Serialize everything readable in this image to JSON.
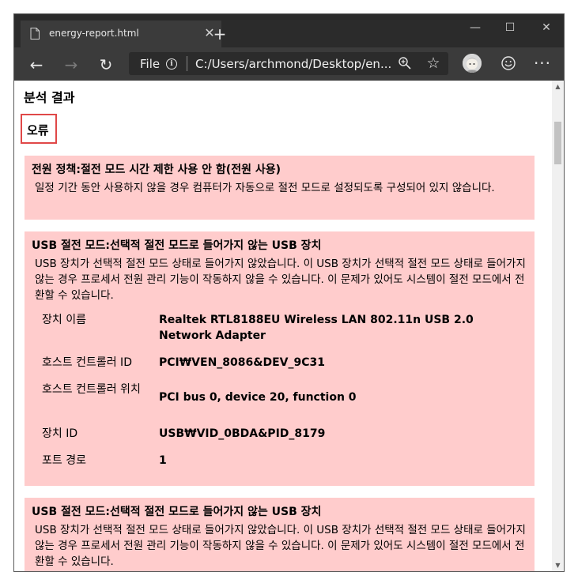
{
  "browser": {
    "tab_title": "energy-report.html",
    "new_tab_symbol": "+",
    "tab_close_symbol": "✕",
    "minimize_symbol": "—",
    "maximize_symbol": "☐",
    "close_symbol": "✕",
    "back_symbol": "←",
    "forward_symbol": "→",
    "refresh_symbol": "↻",
    "address_scheme_label": "File",
    "address_info_symbol": "i",
    "address_url": "C:/Users/archmond/Desktop/en...",
    "favorite_symbol": "☆",
    "more_symbol": "···"
  },
  "page": {
    "section_title": "분석 결과",
    "error_heading": "오류",
    "cards": [
      {
        "title": "전원 정책:절전 모드 시간 제한 사용 안 함(전원 사용)",
        "description": "일정 기간 동안 사용하지 않을 경우 컴퓨터가 자동으로 절전 모드로 설정되도록 구성되어 있지 않습니다."
      },
      {
        "title": "USB 절전 모드:선택적 절전 모드로 들어가지 않는 USB 장치",
        "description": "USB 장치가 선택적 절전 모드 상태로 들어가지 않았습니다. 이 USB 장치가 선택적 절전 모드 상태로 들어가지 않는 경우 프로세서 전원 관리 기능이 작동하지 않을 수 있습니다. 이 문제가 있어도 시스템이 절전 모드에서 전환할 수 있습니다.",
        "details": [
          {
            "key": "장치 이름",
            "value": "Realtek RTL8188EU Wireless LAN 802.11n USB 2.0 Network Adapter"
          },
          {
            "key": "호스트 컨트롤러 ID",
            "value": "PCI₩VEN_8086&DEV_9C31"
          },
          {
            "key": "호스트 컨트롤러 위치",
            "value": "PCI bus 0, device 20, function 0"
          },
          {
            "key": "장치 ID",
            "value": "USB₩VID_0BDA&PID_8179"
          },
          {
            "key": "포트 경로",
            "value": "1"
          }
        ]
      },
      {
        "title": "USB 절전 모드:선택적 절전 모드로 들어가지 않는 USB 장치",
        "description": "USB 장치가 선택적 절전 모드 상태로 들어가지 않았습니다. 이 USB 장치가 선택적 절전 모드 상태로 들어가지 않는 경우 프로세서 전원 관리 기능이 작동하지 않을 수 있습니다. 이 문제가 있어도 시스템이 절전 모드에서 전환할 수 있습니다."
      }
    ]
  },
  "colors": {
    "card_background": "#ffcccc",
    "highlight_border": "#e04848",
    "chrome_dark": "#2b2b2b",
    "chrome_toolbar": "#3b3b3b"
  }
}
